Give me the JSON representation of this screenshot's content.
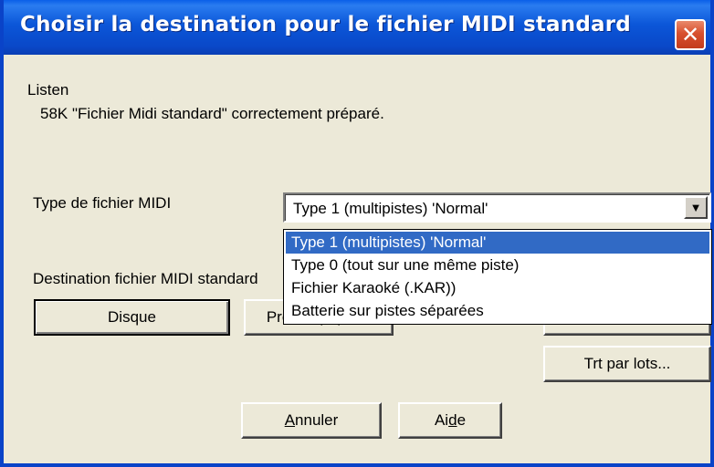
{
  "window": {
    "title": "Choisir la destination pour le fichier MIDI standard",
    "close_glyph": "✕"
  },
  "info": {
    "song_name": "Listen",
    "status": "58K \"Fichier Midi standard\" correctement préparé."
  },
  "midi_type": {
    "label": "Type de fichier MIDI",
    "selected": "Type 1 (multipistes) 'Normal'",
    "options": [
      "Type 1 (multipistes) 'Normal'",
      "Type 0 (tout sur une même piste)",
      "Fichier Karaoké (.KAR))",
      "Batterie sur pistes séparées"
    ],
    "arrow_glyph": "▼"
  },
  "destination": {
    "label": "Destination fichier MIDI standard",
    "disk_button": "Disque",
    "second_button": "Presse-papiers"
  },
  "batch_button": "Trt par lots...",
  "cancel_button": {
    "mnemonic": "A",
    "rest": "nnuler"
  },
  "help_button": {
    "before": "Ai",
    "mnemonic": "d",
    "after": "e"
  },
  "icons": {
    "close": "close-icon",
    "dropdown": "chevron-down-icon"
  }
}
